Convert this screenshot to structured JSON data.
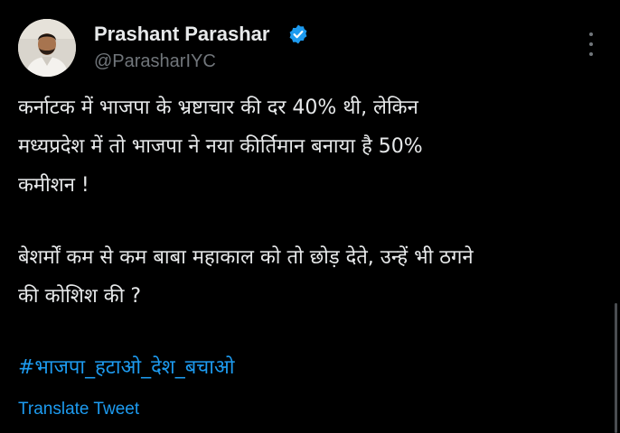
{
  "author": {
    "display_name": "Prashant Parashar",
    "handle": "@ParasharIYC",
    "verified": true,
    "avatar": "profile-photo"
  },
  "tweet": {
    "lines_p1": [
      "कर्नाटक में भाजपा के भ्रष्टाचार की दर 40% थी, लेकिन",
      "मध्यप्रदेश में तो भाजपा ने नया कीर्तिमान बनाया है 50%",
      "कमीशन !"
    ],
    "lines_p2": [
      "बेशर्मों कम से कम बाबा महाकाल को तो छोड़ देते, उन्हें भी ठगने",
      "की कोशिश की ?"
    ],
    "hashtag": "#भाजपा_हटाओ_देश_बचाओ",
    "translate_label": "Translate Tweet"
  },
  "icons": {
    "verified": "verified-badge-icon",
    "more": "more-options-icon"
  },
  "colors": {
    "background": "#000000",
    "text": "#e7e9ea",
    "secondary": "#71767b",
    "accent": "#1d9bf0"
  }
}
